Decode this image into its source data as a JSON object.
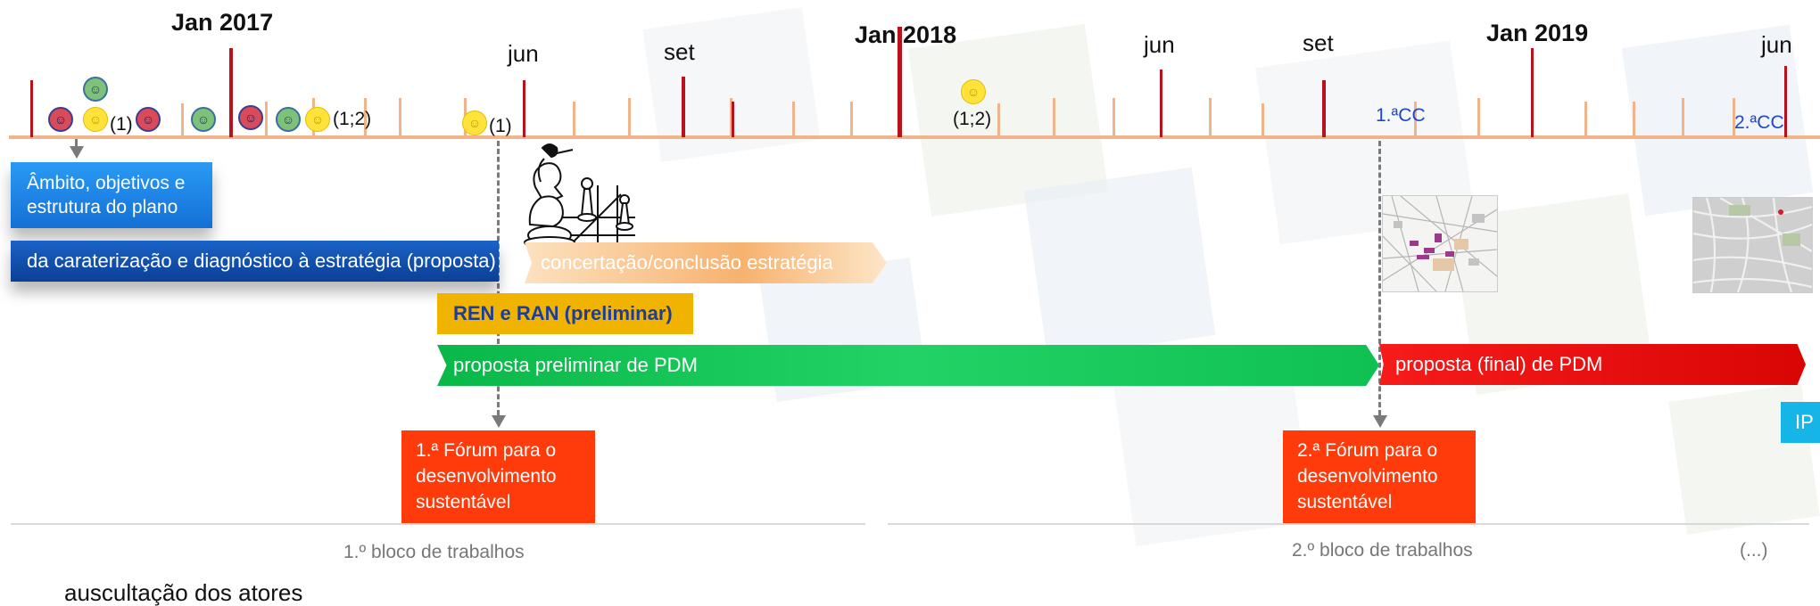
{
  "timeline": {
    "years": [
      "Jan 2017",
      "Jan 2018",
      "Jan 2019"
    ],
    "months": [
      "jun",
      "set",
      "jun",
      "set",
      "jun"
    ],
    "footnotes": [
      "(1)",
      "(1;2)",
      "(1)",
      "(1;2)"
    ],
    "cc_markers": [
      "1.ªCC",
      "2.ªCC"
    ]
  },
  "phases": {
    "ambito": "Âmbito, objetivos e estrutura do plano",
    "caraterizacao": "da caraterização e diagnóstico à estratégia (proposta)",
    "concertacao": "concertação/conclusão estratégia",
    "ren_ran": "REN e RAN (preliminar)",
    "proposta_preliminar": "proposta preliminar de PDM",
    "proposta_final": "proposta (final) de PDM",
    "ip": "IP"
  },
  "forums": {
    "forum1": "1.ª Fórum para o desenvolvimento sustentável",
    "forum2": "2.ª Fórum para o desenvolvimento sustentável"
  },
  "blocks": {
    "bloco1": "1.º bloco de trabalhos",
    "bloco2": "2.º bloco de trabalhos",
    "continuation": "(...)"
  },
  "footer": {
    "legend_label": "auscultação dos atores"
  },
  "icons": {
    "faces": [
      "red-smiley-icon",
      "green-smiley-icon",
      "yellow-smiley-icon"
    ],
    "chess": "chess-pieces-icon",
    "maps": "map-thumbnail-icon"
  },
  "colors": {
    "major_tick": "#b8121c",
    "minor_tick": "#f1b48a",
    "blue_phase": "#1b7fe0",
    "dark_blue_phase": "#0f4fae",
    "orange_phase": "#f7c28a",
    "ren_ran": "#f0b400",
    "green_phase": "#16c75a",
    "red_phase": "#e10f0f",
    "forum": "#ff3b0c",
    "ip": "#16b5e8"
  }
}
